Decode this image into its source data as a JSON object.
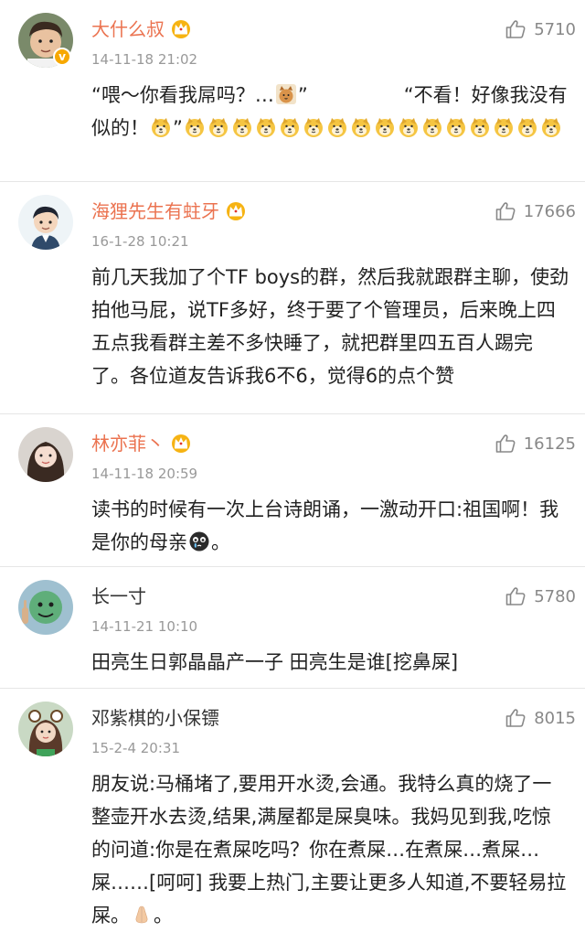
{
  "comments": [
    {
      "username": "大什么叔",
      "time": "14-11-18 21:02",
      "likes": "5710",
      "text_a": "“喂～你看我屌吗？…",
      "text_b": "”　　　　　“不看！好像我没有似的！",
      "text_c": "”",
      "vip": true,
      "verified": true,
      "avatar_icon": "man-avatar-icon"
    },
    {
      "username": "海狸先生有蛀牙",
      "time": "16-1-28 10:21",
      "likes": "17666",
      "text": "前几天我加了个TF boys的群，然后我就跟群主聊，使劲拍他马屁，说TF多好，终于要了个管理员，后来晚上四五点我看群主差不多快睡了，就把群里四五百人踢完了。各位道友告诉我6不6，觉得6的点个赞",
      "vip": true
    },
    {
      "username": "林亦菲丶",
      "time": "14-11-18 20:59",
      "likes": "16125",
      "text": "读书的时候有一次上台诗朗诵，一激动开口:祖国啊！我是你的母亲",
      "text_end": "。",
      "vip": true
    },
    {
      "username": "长一寸",
      "time": "14-11-21 10:10",
      "likes": "5780",
      "text": "田亮生日郭晶晶产一子 田亮生是谁[挖鼻屎]",
      "vip": false
    },
    {
      "username": "邓紫棋的小保镖",
      "time": "15-2-4 20:31",
      "likes": "8015",
      "text": "朋友说:马桶堵了,要用开水烫,会通。我特么真的烧了一整壶开水去烫,结果,满屋都是屎臭味。我妈见到我,吃惊的问道:你是在煮屎吃吗？你在煮屎…在煮屎…煮屎…屎……[呵呵] 我要上热门,主要让更多人知道,不要轻易拉屎。",
      "text_end": "。",
      "vip": false
    }
  ],
  "colors": {
    "vip_name": "#eb7350",
    "normal_name": "#333333",
    "meta": "#999999",
    "divider": "#e6e6e6"
  }
}
